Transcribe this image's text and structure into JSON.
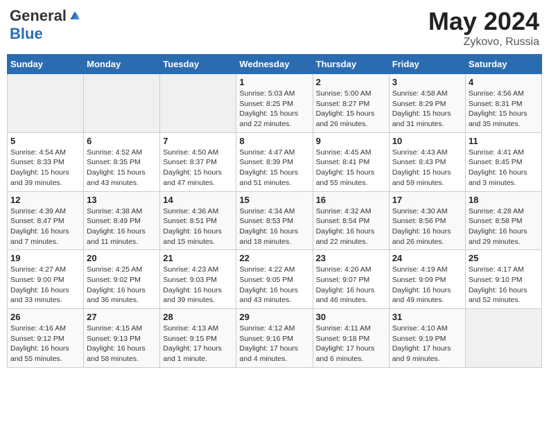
{
  "header": {
    "logo_general": "General",
    "logo_blue": "Blue",
    "month_year": "May 2024",
    "location": "Zykovo, Russia"
  },
  "days_of_week": [
    "Sunday",
    "Monday",
    "Tuesday",
    "Wednesday",
    "Thursday",
    "Friday",
    "Saturday"
  ],
  "weeks": [
    [
      {
        "day": "",
        "sunrise": "",
        "sunset": "",
        "daylight": ""
      },
      {
        "day": "",
        "sunrise": "",
        "sunset": "",
        "daylight": ""
      },
      {
        "day": "",
        "sunrise": "",
        "sunset": "",
        "daylight": ""
      },
      {
        "day": "1",
        "sunrise": "Sunrise: 5:03 AM",
        "sunset": "Sunset: 8:25 PM",
        "daylight": "Daylight: 15 hours and 22 minutes."
      },
      {
        "day": "2",
        "sunrise": "Sunrise: 5:00 AM",
        "sunset": "Sunset: 8:27 PM",
        "daylight": "Daylight: 15 hours and 26 minutes."
      },
      {
        "day": "3",
        "sunrise": "Sunrise: 4:58 AM",
        "sunset": "Sunset: 8:29 PM",
        "daylight": "Daylight: 15 hours and 31 minutes."
      },
      {
        "day": "4",
        "sunrise": "Sunrise: 4:56 AM",
        "sunset": "Sunset: 8:31 PM",
        "daylight": "Daylight: 15 hours and 35 minutes."
      }
    ],
    [
      {
        "day": "5",
        "sunrise": "Sunrise: 4:54 AM",
        "sunset": "Sunset: 8:33 PM",
        "daylight": "Daylight: 15 hours and 39 minutes."
      },
      {
        "day": "6",
        "sunrise": "Sunrise: 4:52 AM",
        "sunset": "Sunset: 8:35 PM",
        "daylight": "Daylight: 15 hours and 43 minutes."
      },
      {
        "day": "7",
        "sunrise": "Sunrise: 4:50 AM",
        "sunset": "Sunset: 8:37 PM",
        "daylight": "Daylight: 15 hours and 47 minutes."
      },
      {
        "day": "8",
        "sunrise": "Sunrise: 4:47 AM",
        "sunset": "Sunset: 8:39 PM",
        "daylight": "Daylight: 15 hours and 51 minutes."
      },
      {
        "day": "9",
        "sunrise": "Sunrise: 4:45 AM",
        "sunset": "Sunset: 8:41 PM",
        "daylight": "Daylight: 15 hours and 55 minutes."
      },
      {
        "day": "10",
        "sunrise": "Sunrise: 4:43 AM",
        "sunset": "Sunset: 8:43 PM",
        "daylight": "Daylight: 15 hours and 59 minutes."
      },
      {
        "day": "11",
        "sunrise": "Sunrise: 4:41 AM",
        "sunset": "Sunset: 8:45 PM",
        "daylight": "Daylight: 16 hours and 3 minutes."
      }
    ],
    [
      {
        "day": "12",
        "sunrise": "Sunrise: 4:39 AM",
        "sunset": "Sunset: 8:47 PM",
        "daylight": "Daylight: 16 hours and 7 minutes."
      },
      {
        "day": "13",
        "sunrise": "Sunrise: 4:38 AM",
        "sunset": "Sunset: 8:49 PM",
        "daylight": "Daylight: 16 hours and 11 minutes."
      },
      {
        "day": "14",
        "sunrise": "Sunrise: 4:36 AM",
        "sunset": "Sunset: 8:51 PM",
        "daylight": "Daylight: 16 hours and 15 minutes."
      },
      {
        "day": "15",
        "sunrise": "Sunrise: 4:34 AM",
        "sunset": "Sunset: 8:53 PM",
        "daylight": "Daylight: 16 hours and 18 minutes."
      },
      {
        "day": "16",
        "sunrise": "Sunrise: 4:32 AM",
        "sunset": "Sunset: 8:54 PM",
        "daylight": "Daylight: 16 hours and 22 minutes."
      },
      {
        "day": "17",
        "sunrise": "Sunrise: 4:30 AM",
        "sunset": "Sunset: 8:56 PM",
        "daylight": "Daylight: 16 hours and 26 minutes."
      },
      {
        "day": "18",
        "sunrise": "Sunrise: 4:28 AM",
        "sunset": "Sunset: 8:58 PM",
        "daylight": "Daylight: 16 hours and 29 minutes."
      }
    ],
    [
      {
        "day": "19",
        "sunrise": "Sunrise: 4:27 AM",
        "sunset": "Sunset: 9:00 PM",
        "daylight": "Daylight: 16 hours and 33 minutes."
      },
      {
        "day": "20",
        "sunrise": "Sunrise: 4:25 AM",
        "sunset": "Sunset: 9:02 PM",
        "daylight": "Daylight: 16 hours and 36 minutes."
      },
      {
        "day": "21",
        "sunrise": "Sunrise: 4:23 AM",
        "sunset": "Sunset: 9:03 PM",
        "daylight": "Daylight: 16 hours and 39 minutes."
      },
      {
        "day": "22",
        "sunrise": "Sunrise: 4:22 AM",
        "sunset": "Sunset: 9:05 PM",
        "daylight": "Daylight: 16 hours and 43 minutes."
      },
      {
        "day": "23",
        "sunrise": "Sunrise: 4:20 AM",
        "sunset": "Sunset: 9:07 PM",
        "daylight": "Daylight: 16 hours and 46 minutes."
      },
      {
        "day": "24",
        "sunrise": "Sunrise: 4:19 AM",
        "sunset": "Sunset: 9:09 PM",
        "daylight": "Daylight: 16 hours and 49 minutes."
      },
      {
        "day": "25",
        "sunrise": "Sunrise: 4:17 AM",
        "sunset": "Sunset: 9:10 PM",
        "daylight": "Daylight: 16 hours and 52 minutes."
      }
    ],
    [
      {
        "day": "26",
        "sunrise": "Sunrise: 4:16 AM",
        "sunset": "Sunset: 9:12 PM",
        "daylight": "Daylight: 16 hours and 55 minutes."
      },
      {
        "day": "27",
        "sunrise": "Sunrise: 4:15 AM",
        "sunset": "Sunset: 9:13 PM",
        "daylight": "Daylight: 16 hours and 58 minutes."
      },
      {
        "day": "28",
        "sunrise": "Sunrise: 4:13 AM",
        "sunset": "Sunset: 9:15 PM",
        "daylight": "Daylight: 17 hours and 1 minute."
      },
      {
        "day": "29",
        "sunrise": "Sunrise: 4:12 AM",
        "sunset": "Sunset: 9:16 PM",
        "daylight": "Daylight: 17 hours and 4 minutes."
      },
      {
        "day": "30",
        "sunrise": "Sunrise: 4:11 AM",
        "sunset": "Sunset: 9:18 PM",
        "daylight": "Daylight: 17 hours and 6 minutes."
      },
      {
        "day": "31",
        "sunrise": "Sunrise: 4:10 AM",
        "sunset": "Sunset: 9:19 PM",
        "daylight": "Daylight: 17 hours and 9 minutes."
      },
      {
        "day": "",
        "sunrise": "",
        "sunset": "",
        "daylight": ""
      }
    ]
  ]
}
